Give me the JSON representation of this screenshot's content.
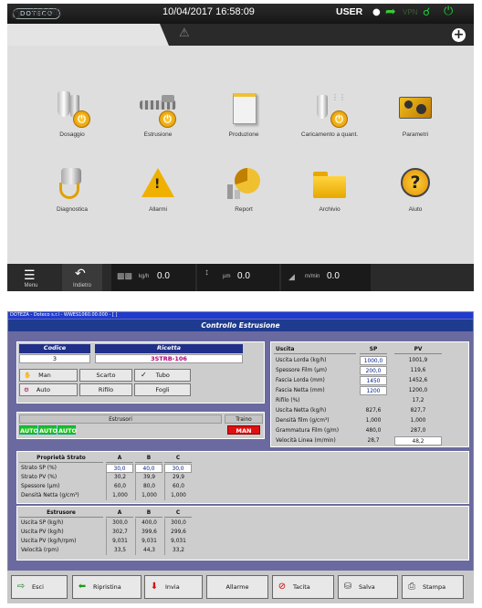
{
  "hmi": {
    "datetime": "10/04/2017 16:58:09",
    "user": "USER",
    "vpn": "VPN",
    "home": "HOME",
    "tiles": [
      {
        "label": "Dosaggio",
        "icon": "dosing-icon"
      },
      {
        "label": "Estrusione",
        "icon": "extrusion-icon"
      },
      {
        "label": "Produzione",
        "icon": "production-icon"
      },
      {
        "label": "Caricamento a quant.",
        "icon": "loading-icon"
      },
      {
        "label": "Parametri",
        "icon": "parameters-icon"
      },
      {
        "label": "Diagnostica",
        "icon": "diagnostics-icon"
      },
      {
        "label": "Allarmi",
        "icon": "alarm-icon"
      },
      {
        "label": "Report",
        "icon": "report-icon"
      },
      {
        "label": "Archivio",
        "icon": "archive-icon"
      },
      {
        "label": "Aiuto",
        "icon": "help-icon"
      }
    ],
    "bottom": {
      "menu": "Menu",
      "back": "Indietro",
      "kgh_unit": "kg/h",
      "kgh": "0.0",
      "um_unit": "µm",
      "um": "0.0",
      "mmin_unit": "m/min",
      "mmin": "0.0"
    }
  },
  "win": {
    "title": "DOTEZA - Doteco s.r.l - WWES1060.00.000 - [ ]",
    "panel_title": "Controllo Estrusione",
    "codice_label": "Codice",
    "codice": "3",
    "ricetta_label": "Ricetta",
    "ricetta": "3STRB-106",
    "buttons": {
      "man": "Man",
      "scarto": "Scarto",
      "tubo": "Tubo",
      "auto": "Auto",
      "rifilo": "Rifilo",
      "fogli": "Fogli"
    },
    "estrusori_label": "Estrusori",
    "traino_label": "Traino",
    "auto_flags": [
      "AUTO",
      "AUTO",
      "AUTO"
    ],
    "traino": "MAN",
    "uscita": {
      "headers": [
        "Uscita",
        "SP",
        "PV"
      ],
      "rows": [
        [
          "Uscita Lorda (kg/h)",
          "1000,0",
          "1001,9"
        ],
        [
          "Spessore Film (µm)",
          "200,0",
          "119,6"
        ],
        [
          "Fascia Lorda (mm)",
          "1450",
          "1452,6"
        ],
        [
          "Fascia Netta (mm)",
          "1200",
          "1200,0"
        ],
        [
          "Rifilo (%)",
          "",
          "17,2"
        ],
        [
          "Uscita Netta (kg/h)",
          "827,6",
          "827,7"
        ],
        [
          "Densità film (g/cm³)",
          "1,000",
          "1,000"
        ],
        [
          "Grammatura Film (g/m)",
          "480,0",
          "287,0"
        ],
        [
          "Velocità Linea (m/min)",
          "28,7",
          "48,2"
        ]
      ]
    },
    "strato": {
      "headers": [
        "Proprietà Strato",
        "A",
        "B",
        "C"
      ],
      "rows": [
        [
          "Strato SP (%)",
          "30,0",
          "40,0",
          "30,0"
        ],
        [
          "Strato PV (%)",
          "30,2",
          "39,9",
          "29,9"
        ],
        [
          "Spessore (µm)",
          "60,0",
          "80,0",
          "60,0"
        ],
        [
          "Densità Netta (g/cm³)",
          "1,000",
          "1,000",
          "1,000"
        ]
      ]
    },
    "estrusore": {
      "headers": [
        "Estrusore",
        "A",
        "B",
        "C"
      ],
      "rows": [
        [
          "Uscita SP (kg/h)",
          "300,0",
          "400,0",
          "300,0"
        ],
        [
          "Uscita PV (kg/h)",
          "302,7",
          "399,6",
          "299,6"
        ],
        [
          "Uscita PV (kg/h/rpm)",
          "9,031",
          "9,031",
          "9,031"
        ],
        [
          "Velocità (rpm)",
          "33,5",
          "44,3",
          "33,2"
        ]
      ]
    },
    "toolbar": [
      "Esci",
      "Ripristina",
      "Invia",
      "Allarme",
      "Tacita",
      "Salva",
      "Stampa"
    ]
  }
}
